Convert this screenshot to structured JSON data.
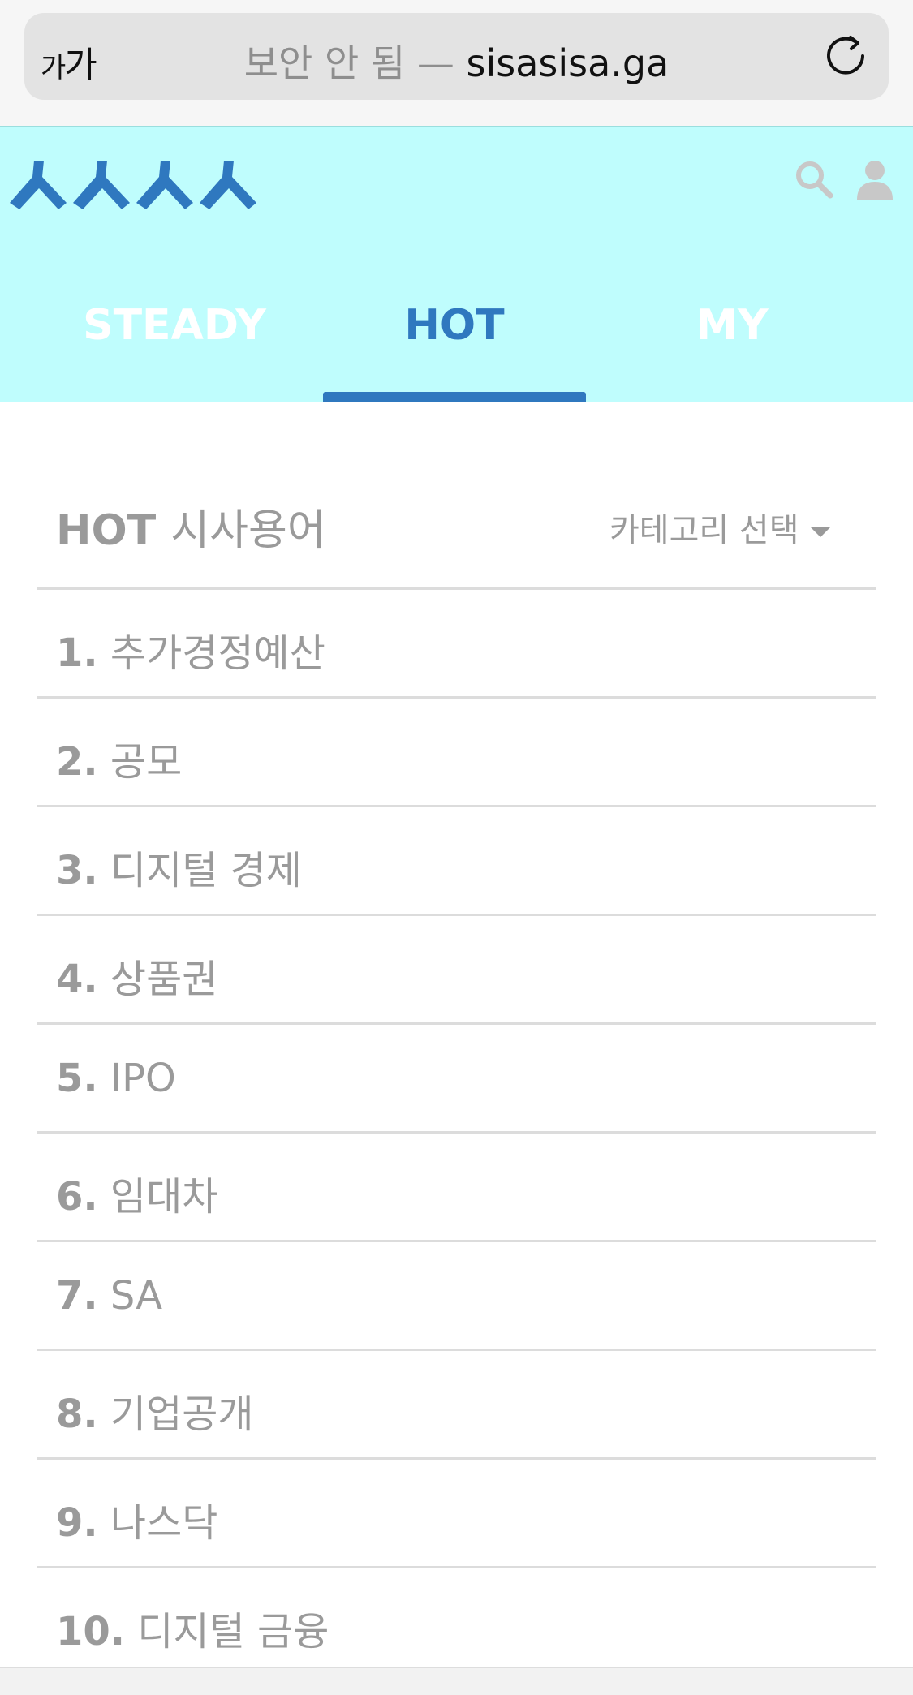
{
  "browser": {
    "aa_label_small": "가",
    "aa_label_large": "가",
    "insecure_label": "보안 안 됨 —",
    "domain": "sisasisa.ga"
  },
  "header": {
    "logo_icon": "sisa-logo-icon",
    "search_icon": "search-icon",
    "user_icon": "user-icon",
    "tabs": [
      {
        "label": "STEADY",
        "active": false
      },
      {
        "label": "HOT",
        "active": true
      },
      {
        "label": "MY",
        "active": false
      }
    ]
  },
  "list": {
    "title_en": "HOT",
    "title_kr": "시사용어",
    "category_label": "카테고리 선택",
    "items": [
      {
        "num": "1.",
        "term": "추가경정예산"
      },
      {
        "num": "2.",
        "term": "공모"
      },
      {
        "num": "3.",
        "term": "디지털 경제"
      },
      {
        "num": "4.",
        "term": "상품권"
      },
      {
        "num": "5.",
        "term": "IPO"
      },
      {
        "num": "6.",
        "term": "임대차"
      },
      {
        "num": "7.",
        "term": "SA"
      },
      {
        "num": "8.",
        "term": "기업공개"
      },
      {
        "num": "9.",
        "term": "나스닥"
      },
      {
        "num": "10.",
        "term": "디지털 금융"
      }
    ]
  },
  "colors": {
    "header_bg": "#bffdfd",
    "accent": "#2f78bf",
    "muted_text": "#9a9a9a"
  }
}
